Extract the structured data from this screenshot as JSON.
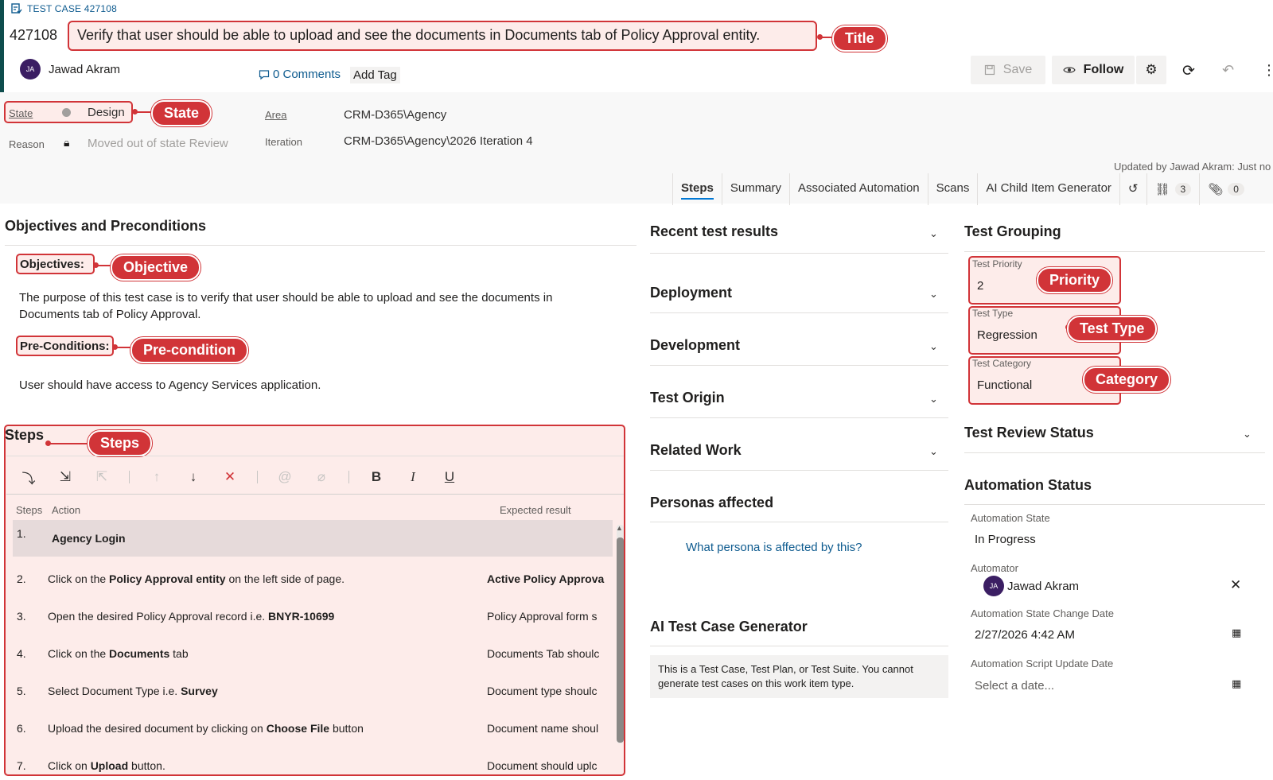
{
  "header": {
    "type_label": "TEST CASE 427108",
    "id": "427108",
    "title": "Verify that user should be able to upload and see the documents in Documents tab of Policy Approval entity.",
    "assignee_initials": "JA",
    "assignee_name": "Jawad Akram",
    "comments": "0 Comments",
    "add_tag": "Add Tag",
    "save_label": "Save",
    "follow_label": "Follow",
    "updated_by": "Updated by Jawad Akram: Just no"
  },
  "callouts": {
    "title": "Title",
    "state": "State",
    "objective": "Objective",
    "precondition": "Pre-condition",
    "steps": "Steps",
    "priority": "Priority",
    "test_type": "Test Type",
    "category": "Category"
  },
  "fields": {
    "state_label": "State",
    "state_value": "Design",
    "reason_label": "Reason",
    "reason_value": "Moved out of state Review",
    "area_label": "Area",
    "area_value": "CRM-D365\\Agency",
    "iteration_label": "Iteration",
    "iteration_value": "CRM-D365\\Agency\\2026 Iteration 4"
  },
  "tabs": {
    "steps": "Steps",
    "summary": "Summary",
    "automation": "Associated Automation",
    "scans": "Scans",
    "ai_child": "AI Child Item Generator",
    "links_count": "3",
    "attach_count": "0"
  },
  "objectives": {
    "section_title": "Objectives and Preconditions",
    "objectives_label": "Objectives:",
    "objectives_text": "The purpose of this test case is to verify that user should be able to upload and see the documents in Documents tab of Policy Approval.",
    "precond_label": "Pre-Conditions:",
    "precond_text": "User should have access to Agency Services application."
  },
  "steps": {
    "title": "Steps",
    "col_steps": "Steps",
    "col_action": "Action",
    "col_expected": "Expected result",
    "rows": [
      {
        "num": "1.",
        "pre": "",
        "bold": "Agency Login",
        "post": "",
        "expected": "",
        "exp_bold": false
      },
      {
        "num": "2.",
        "pre": "Click on the ",
        "bold": "Policy Approval entity",
        "post": " on the left side of page.",
        "expected": "Active Policy Approva",
        "exp_bold": true
      },
      {
        "num": "3.",
        "pre": "Open the desired Policy Approval record i.e. ",
        "bold": "BNYR-10699",
        "post": "",
        "expected": "Policy Approval form s",
        "exp_bold": false
      },
      {
        "num": "4.",
        "pre": "Click on the ",
        "bold": "Documents",
        "post": " tab",
        "expected": "Documents Tab shoulc",
        "exp_bold": false
      },
      {
        "num": "5.",
        "pre": "Select Document Type i.e. ",
        "bold": "Survey",
        "post": "",
        "expected": "Document type shoulc",
        "exp_bold": false
      },
      {
        "num": "6.",
        "pre": "Upload the desired document by clicking on ",
        "bold": "Choose File",
        "post": " button",
        "expected": "Document name shoul",
        "exp_bold": false
      },
      {
        "num": "7.",
        "pre": "Click on ",
        "bold": "Upload",
        "post": " button.",
        "expected": "Document should uplc",
        "exp_bold": false
      }
    ]
  },
  "middle": {
    "recent": "Recent test results",
    "deployment": "Deployment",
    "development": "Development",
    "origin": "Test Origin",
    "related": "Related Work",
    "personas": "Personas affected",
    "persona_link": "What persona is affected by this?",
    "ai_title": "AI Test Case Generator",
    "ai_msg": "This is a Test Case, Test Plan, or Test Suite. You cannot generate test cases on this work item type."
  },
  "grouping": {
    "title": "Test Grouping",
    "priority_label": "Test Priority",
    "priority_value": "2",
    "type_label": "Test Type",
    "type_value": "Regression",
    "category_label": "Test Category",
    "category_value": "Functional",
    "review_title": "Test Review Status",
    "automation_title": "Automation Status",
    "auto_state_label": "Automation State",
    "auto_state_value": "In Progress",
    "automator_label": "Automator",
    "automator_initials": "JA",
    "automator_name": "Jawad Akram",
    "change_date_label": "Automation State Change Date",
    "change_date_value": "2/27/2026 4:42 AM",
    "script_date_label": "Automation Script Update Date",
    "script_date_placeholder": "Select a date..."
  },
  "colors": {
    "annotation_red": "#d13438",
    "link_blue": "#0e5b8f",
    "accent": "#0078d4"
  }
}
